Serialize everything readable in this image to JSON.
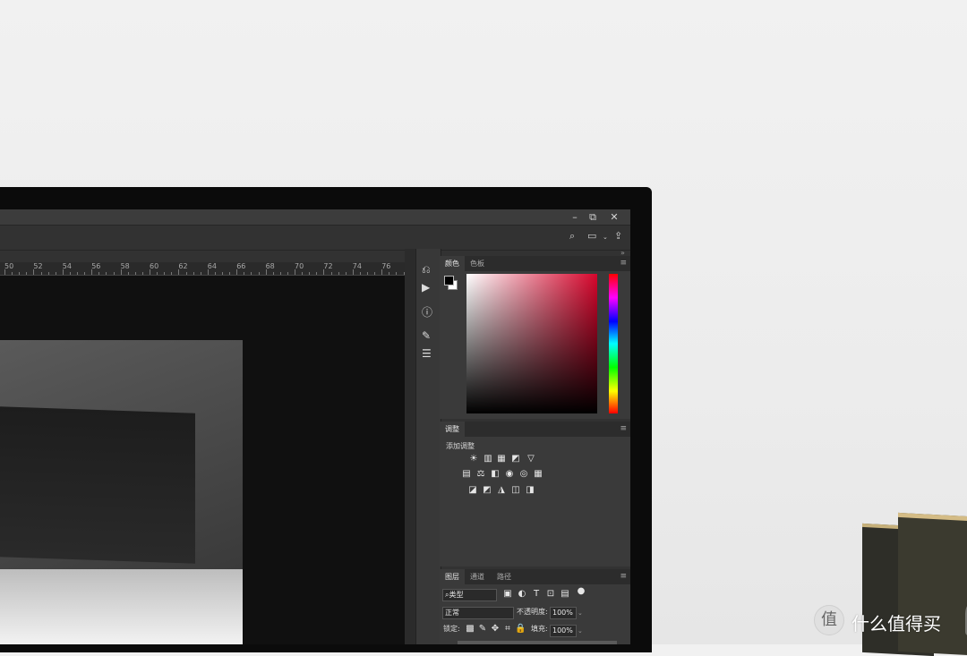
{
  "window": {
    "controls": [
      "–",
      "⧉",
      "✕"
    ]
  },
  "options_bar": {
    "icons": [
      "search-icon",
      "workspace-icon",
      "share-icon"
    ]
  },
  "ruler": {
    "ticks": [
      "50",
      "52",
      "54",
      "56",
      "58",
      "60",
      "62",
      "64",
      "66",
      "68",
      "70",
      "72",
      "74",
      "76"
    ]
  },
  "icon_strip": {
    "items": [
      "history-icon",
      "play-icon",
      "info-icon",
      "brush-icon",
      "sliders-icon"
    ]
  },
  "color_panel": {
    "tabs": [
      "颜色",
      "色板"
    ],
    "foreground": "#000000",
    "background": "#ffffff",
    "picker_hue": "#d6062c"
  },
  "adjustments_panel": {
    "tab": "调整",
    "label": "添加调整",
    "rows": [
      [
        "☀",
        "▥",
        "▦",
        "◩",
        "▽"
      ],
      [
        "▤",
        "⚖",
        "◧",
        "◉",
        "◎",
        "▦"
      ],
      [
        "◪",
        "◩",
        "◮",
        "◫",
        "◨"
      ]
    ]
  },
  "layers_panel": {
    "tabs": [
      "图层",
      "通道",
      "路径"
    ],
    "filter_kind": "类型",
    "blend_mode": "正常",
    "opacity_label": "不透明度:",
    "opacity_value": "100%",
    "lock_label": "锁定:",
    "fill_label": "填充:",
    "fill_value": "100%"
  },
  "watermark": {
    "text": "什么值得买",
    "mark": "值"
  }
}
